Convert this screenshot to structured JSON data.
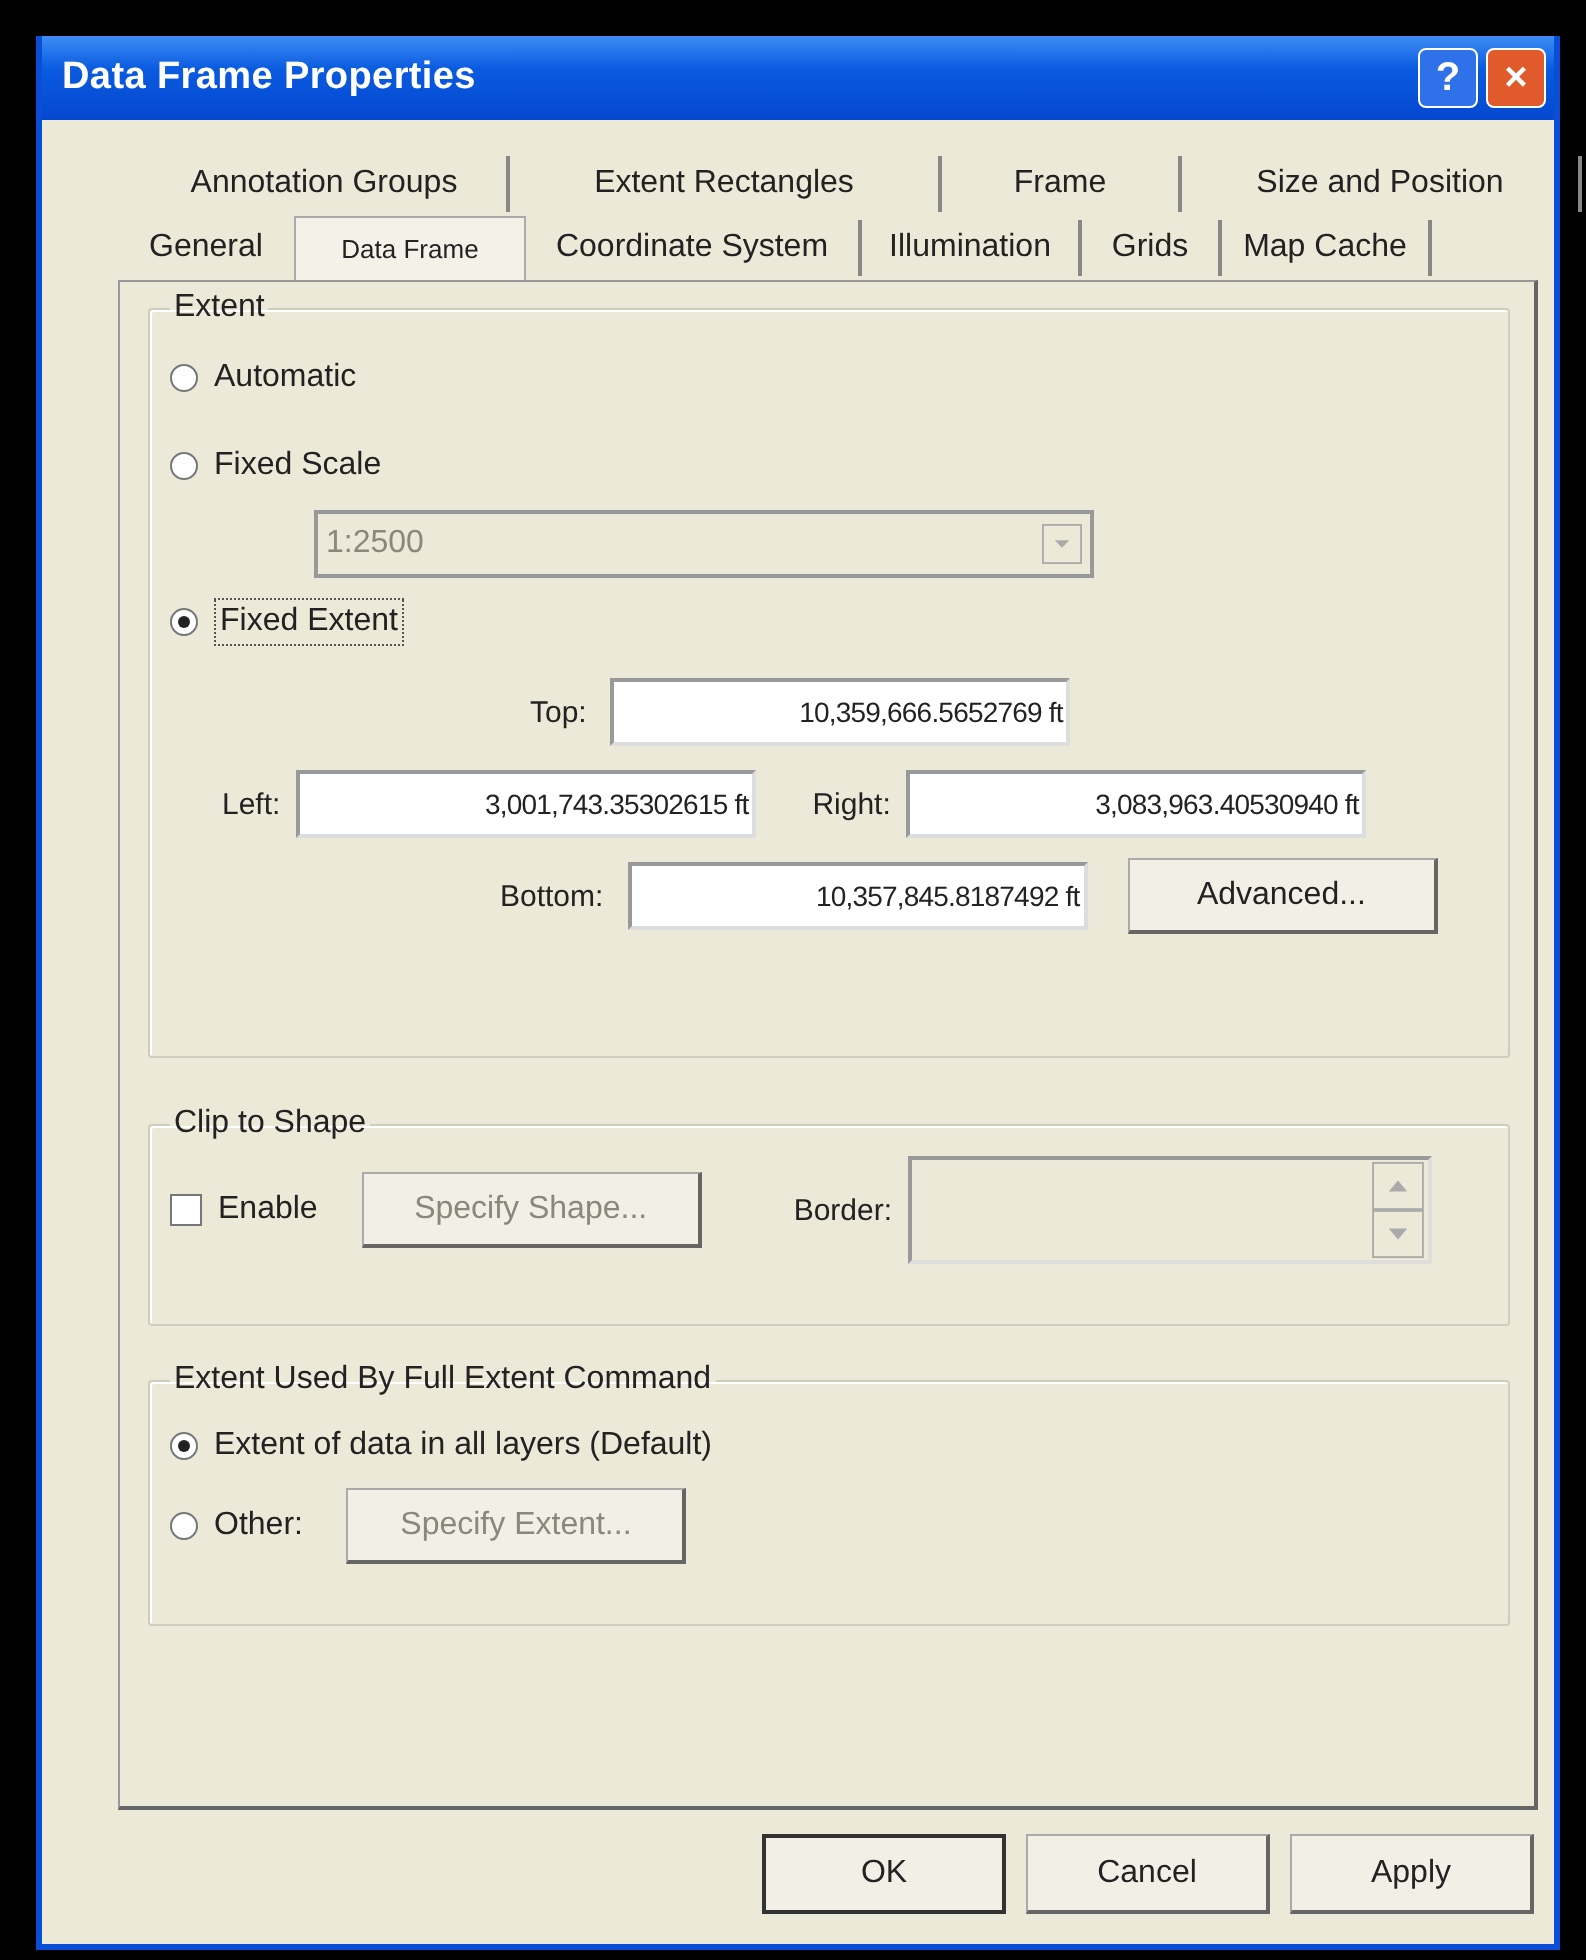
{
  "window": {
    "title": "Data Frame Properties",
    "help": "?",
    "close": "×"
  },
  "tab_rows": [
    [
      {
        "label": "Annotation Groups",
        "selected": false
      },
      {
        "label": "Extent Rectangles",
        "selected": false
      },
      {
        "label": "Frame",
        "selected": false
      },
      {
        "label": "Size and Position",
        "selected": false
      }
    ],
    [
      {
        "label": "General",
        "selected": false
      },
      {
        "label": "Data Frame",
        "selected": true
      },
      {
        "label": "Coordinate System",
        "selected": false
      },
      {
        "label": "Illumination",
        "selected": false
      },
      {
        "label": "Grids",
        "selected": false
      },
      {
        "label": "Map Cache",
        "selected": false
      }
    ]
  ],
  "extent": {
    "title": "Extent",
    "options": [
      {
        "label": "Automatic",
        "selected": false
      },
      {
        "label": "Fixed Scale",
        "selected": false
      },
      {
        "label": "Fixed Extent",
        "selected": true
      }
    ],
    "scale": {
      "value": "1:2500",
      "disabled": true
    },
    "top": {
      "label": "Top:",
      "value": "10,359,666.5652769 ft"
    },
    "left": {
      "label": "Left:",
      "value": "3,001,743.35302615 ft"
    },
    "right": {
      "label": "Right:",
      "value": "3,083,963.40530940 ft"
    },
    "bottom": {
      "label": "Bottom:",
      "value": "10,357,845.8187492 ft"
    },
    "advanced": "Advanced..."
  },
  "clip": {
    "title": "Clip to Shape",
    "enable": {
      "label": "Enable",
      "checked": false
    },
    "specify": {
      "label": "Specify Shape...",
      "disabled": true
    },
    "border": {
      "label": "Border:",
      "disabled": true
    }
  },
  "full_extent": {
    "title": "Extent Used By Full Extent Command",
    "options": [
      {
        "label": "Extent of data in all layers (Default)",
        "selected": true
      },
      {
        "label": "Other:",
        "selected": false
      }
    ],
    "specify": {
      "label": "Specify Extent...",
      "disabled": true
    }
  },
  "buttons": [
    "OK",
    "Cancel",
    "Apply"
  ]
}
